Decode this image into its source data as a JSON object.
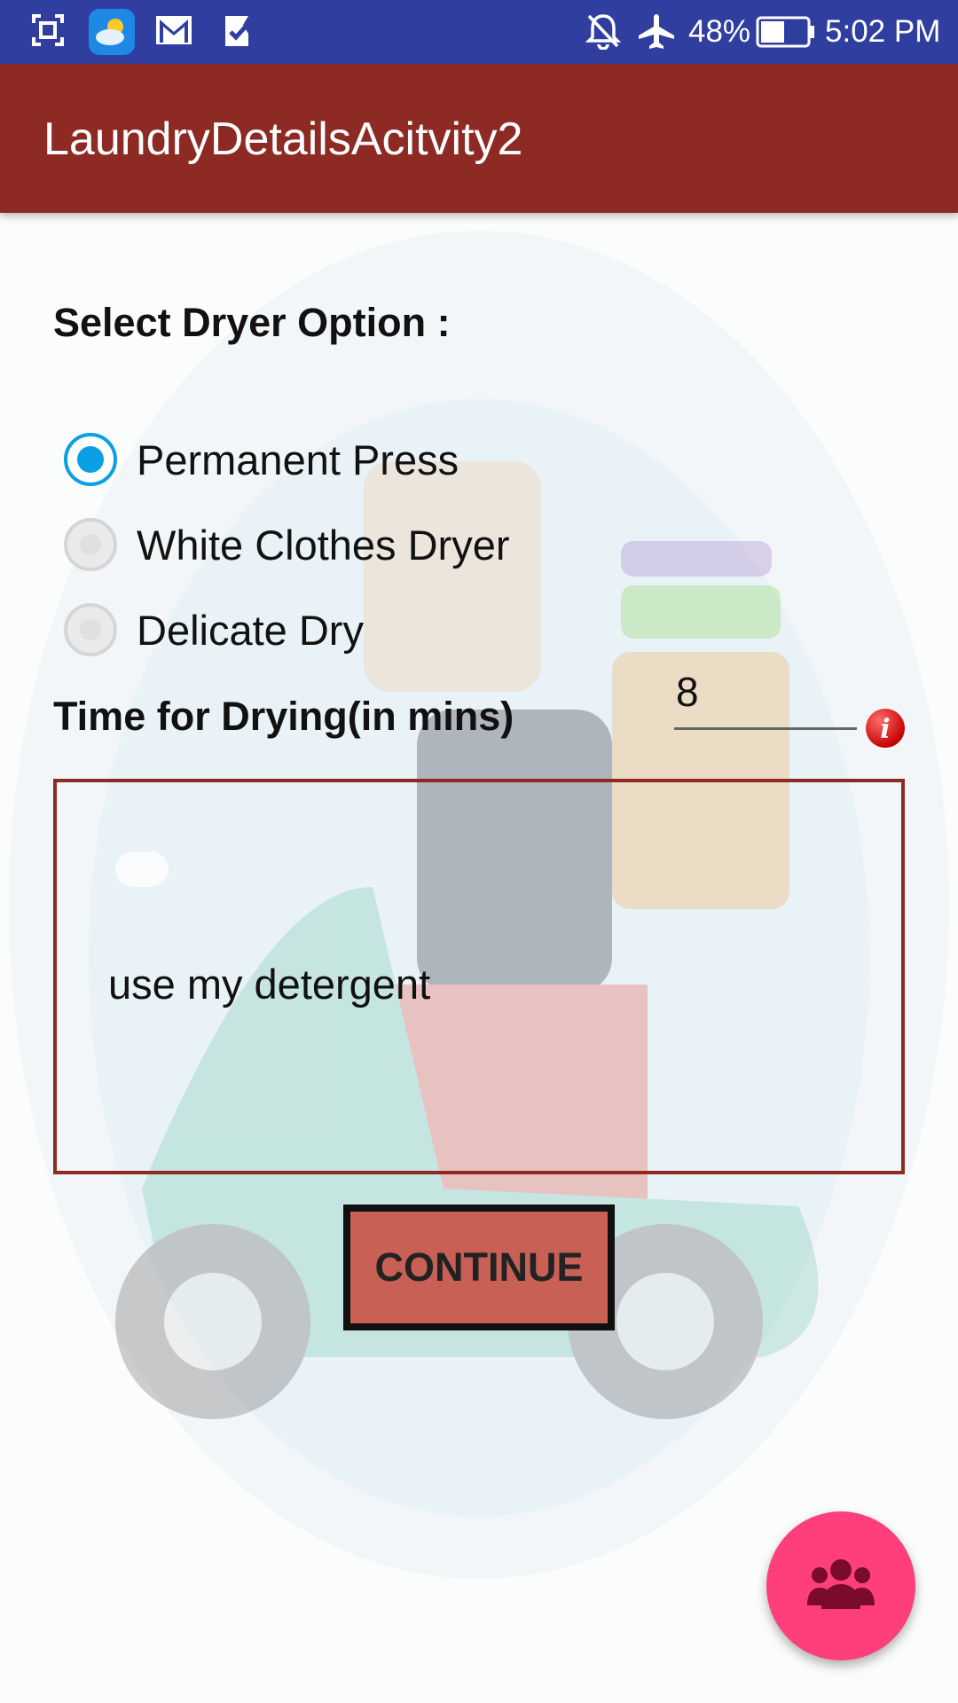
{
  "status_bar": {
    "battery": "48%",
    "time": "5:02 PM",
    "icons": [
      "screenshot-icon",
      "weather-icon",
      "gmail-icon",
      "tasks-icon",
      "notifications-off-icon",
      "airplane-mode-icon",
      "battery-icon"
    ]
  },
  "app_bar": {
    "title": "LaundryDetailsAcitvity2",
    "color": "#8e2a24"
  },
  "dryer_section": {
    "label": "Select Dryer Option :",
    "options": [
      {
        "label": "Permanent Press",
        "checked": true
      },
      {
        "label": "White Clothes Dryer",
        "checked": false
      },
      {
        "label": "Delicate Dry",
        "checked": false
      }
    ],
    "accent": "#0ba0e4"
  },
  "drying_time": {
    "label": "Time for Drying(in mins)",
    "value": "8",
    "error_icon": "error-info-icon"
  },
  "notes": {
    "value": "use my detergent"
  },
  "continue_button": {
    "label": "CONTINUE",
    "color": "#c86055"
  },
  "fab": {
    "icon": "group-icon",
    "color": "#ff3f7b"
  }
}
